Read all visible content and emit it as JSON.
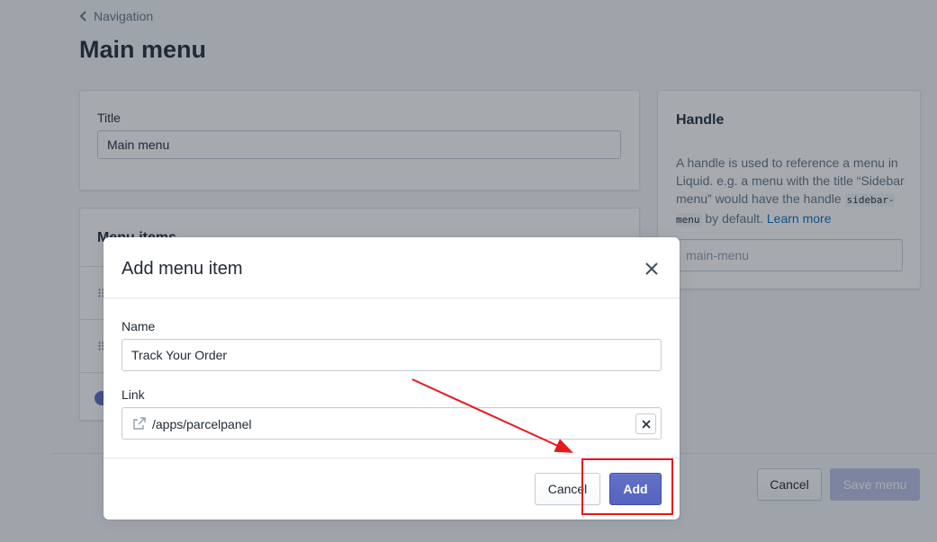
{
  "breadcrumb": {
    "label": "Navigation"
  },
  "page": {
    "title": "Main menu"
  },
  "title_card": {
    "label": "Title",
    "value": "Main menu"
  },
  "handle_card": {
    "heading": "Handle",
    "desc_before": "A handle is used to reference a menu in Liquid. e.g. a menu with the title “Sidebar menu” would have the handle ",
    "code": "sidebar-menu",
    "desc_after": " by default. ",
    "learn_more": "Learn more",
    "input_value": "main-menu"
  },
  "menu_items_card": {
    "heading": "Menu items"
  },
  "page_footer": {
    "cancel": "Cancel",
    "save": "Save menu"
  },
  "modal": {
    "title": "Add menu item",
    "name_label": "Name",
    "name_value": "Track Your Order",
    "link_label": "Link",
    "link_value": "/apps/parcelpanel",
    "cancel": "Cancel",
    "add": "Add"
  },
  "colors": {
    "primary": "#5c6ac4",
    "annotation_red": "#e8191c",
    "link": "#006fbb"
  },
  "icons": [
    "chevron-left-icon",
    "drag-handle-icon",
    "add-circle-icon",
    "close-icon",
    "external-link-icon",
    "clear-icon"
  ]
}
